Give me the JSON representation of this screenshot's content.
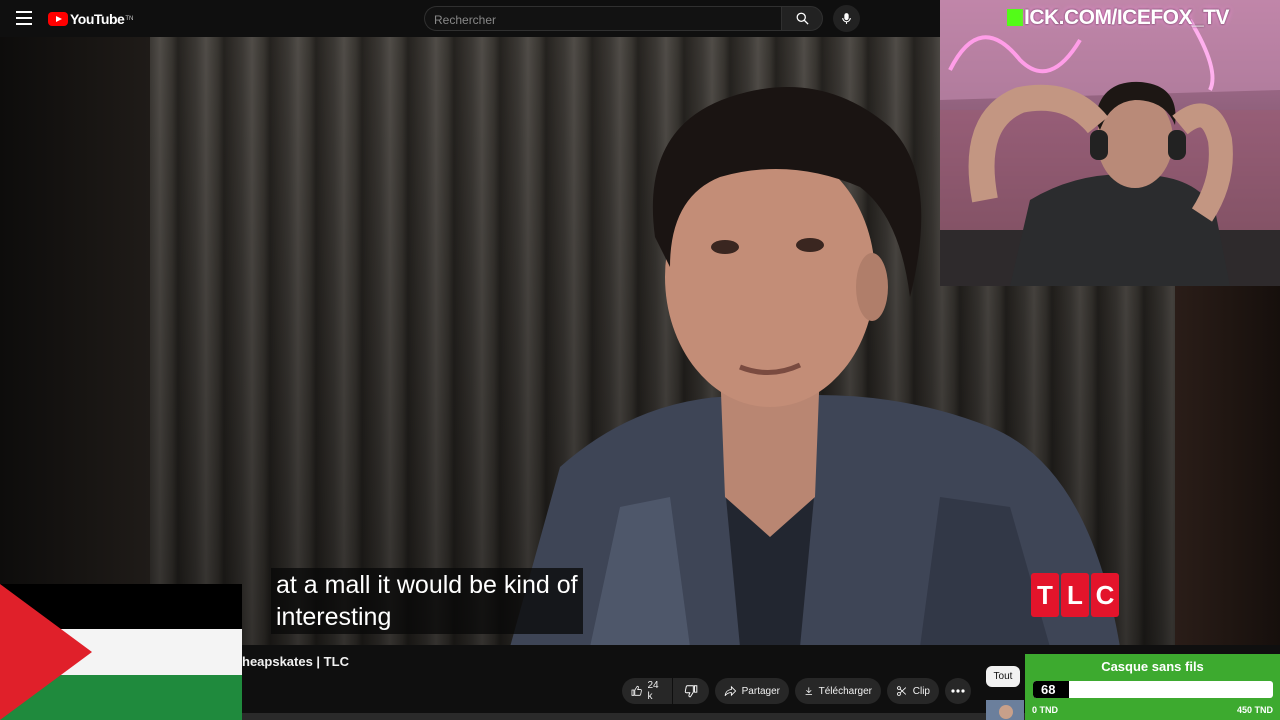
{
  "header": {
    "logo_text": "YouTube",
    "logo_superscript": "TN",
    "search_placeholder": "Rechercher"
  },
  "video": {
    "subtitle_lines": [
      "at a mall it would be kind of",
      "interesting"
    ],
    "channel_watermark": [
      "T",
      "L",
      "C"
    ],
    "title_fragment": "heapskates | TLC"
  },
  "actions": {
    "like_count": "24 k",
    "share_label": "Partager",
    "download_label": "Télécharger",
    "clip_label": "Clip"
  },
  "filters": {
    "chip_all": "Tout"
  },
  "webcam": {
    "title_text": "ICK.COM/ICEFOX_TV"
  },
  "donation_goal": {
    "title": "Casque sans fils",
    "current_count": "68",
    "progress_fraction": 0.15,
    "min_label": "0 TND",
    "max_label": "450 TND"
  },
  "colors": {
    "youtube_red": "#ff0000",
    "tlc_red": "#e3142b",
    "goal_green": "#3daa2f",
    "kick_green": "#53fc18"
  }
}
